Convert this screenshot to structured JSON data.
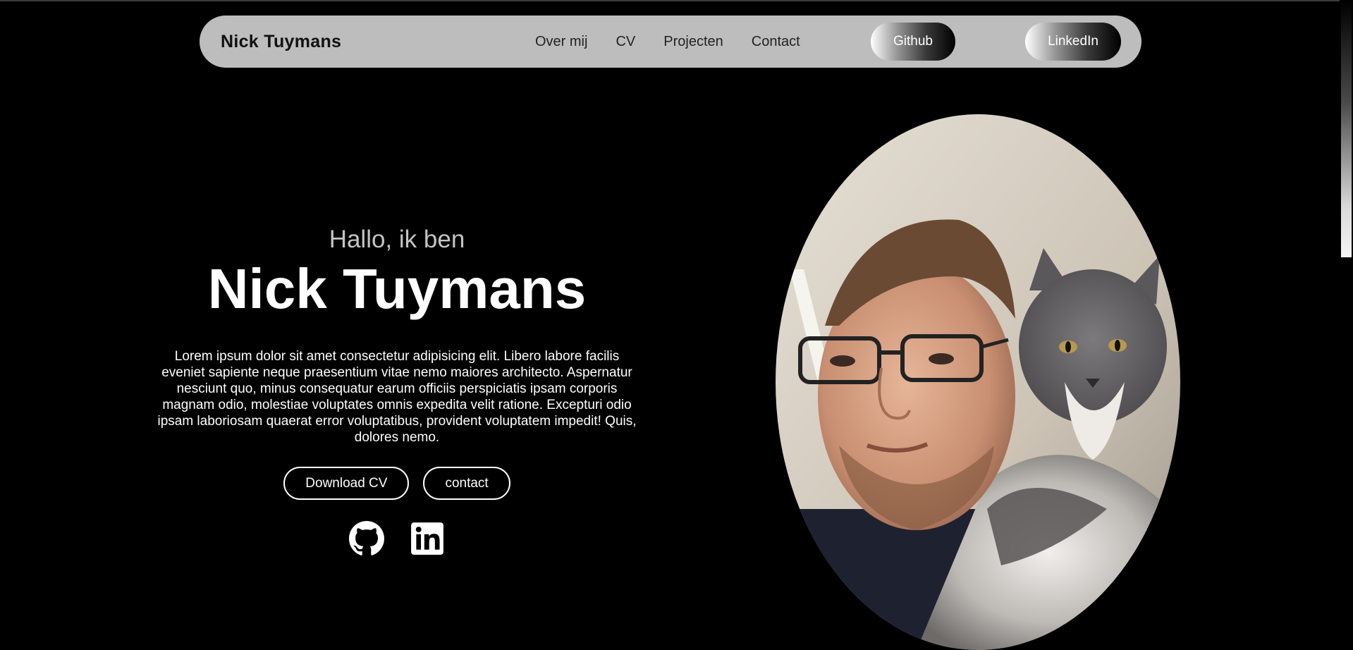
{
  "navbar": {
    "brand": "Nick Tuymans",
    "links": [
      "Over mij",
      "CV",
      "Projecten",
      "Contact"
    ],
    "github_label": "Github",
    "linkedin_label": "LinkedIn"
  },
  "hero": {
    "greeting": "Hallo, ik ben",
    "name": "Nick Tuymans",
    "description": "Lorem ipsum dolor sit amet consectetur adipisicing elit. Libero labore facilis eveniet sapiente neque praesentium vitae nemo maiores architecto. Aspernatur nesciunt quo, minus consequatur earum officiis perspiciatis ipsam corporis magnam odio, molestiae voluptates omnis expedita velit ratione. Excepturi odio ipsam laboriosam quaerat error voluptatibus, provident voluptatem impedit! Quis, dolores nemo.",
    "download_cv_label": "Download CV",
    "contact_label": "contact"
  },
  "socials": {
    "github_icon": "github-icon",
    "linkedin_icon": "linkedin-icon"
  },
  "colors": {
    "background": "#000000",
    "navbar": "#bdbdbd",
    "text": "#ffffff",
    "greeting": "#c4c4c4"
  }
}
